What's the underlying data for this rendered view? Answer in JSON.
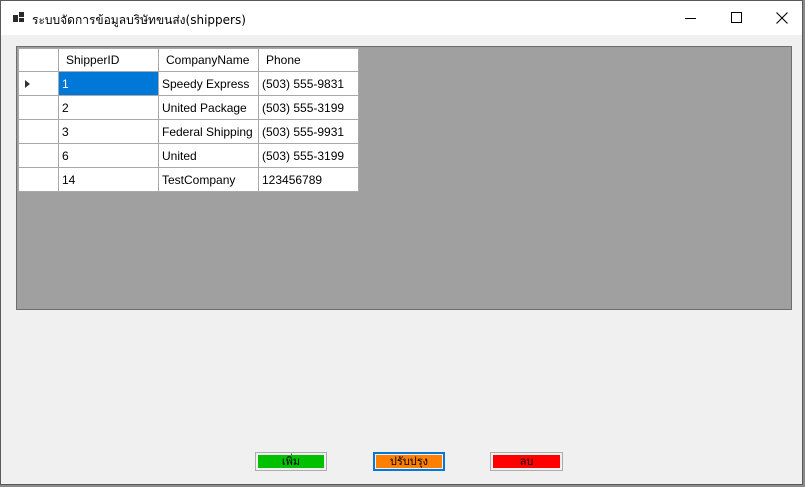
{
  "window": {
    "title": "ระบบจัดการข้อมูลบริษัทขนส่ง(shippers)"
  },
  "icons": {
    "app": "app-icon",
    "minimize": "minimize-icon",
    "maximize": "maximize-icon",
    "close": "close-icon",
    "row_pointer": "row-pointer-icon"
  },
  "grid": {
    "columns": [
      "ShipperID",
      "CompanyName",
      "Phone"
    ],
    "rows": [
      {
        "id": "1",
        "company": "Speedy Express",
        "phone": "(503) 555-9831"
      },
      {
        "id": "2",
        "company": "United Package",
        "phone": "(503) 555-3199"
      },
      {
        "id": "3",
        "company": "Federal Shipping",
        "phone": "(503) 555-9931"
      },
      {
        "id": "6",
        "company": "United",
        "phone": "(503) 555-3199"
      },
      {
        "id": "14",
        "company": "TestCompany",
        "phone": "123456789"
      }
    ],
    "selected_row": 0
  },
  "buttons": {
    "add": "เพิ่ม",
    "update": "ปรับปรุง",
    "delete": "ลบ"
  },
  "colors": {
    "add": "#00c000",
    "update": "#ff8000",
    "delete": "#ff0000",
    "selection": "#0078d7"
  }
}
